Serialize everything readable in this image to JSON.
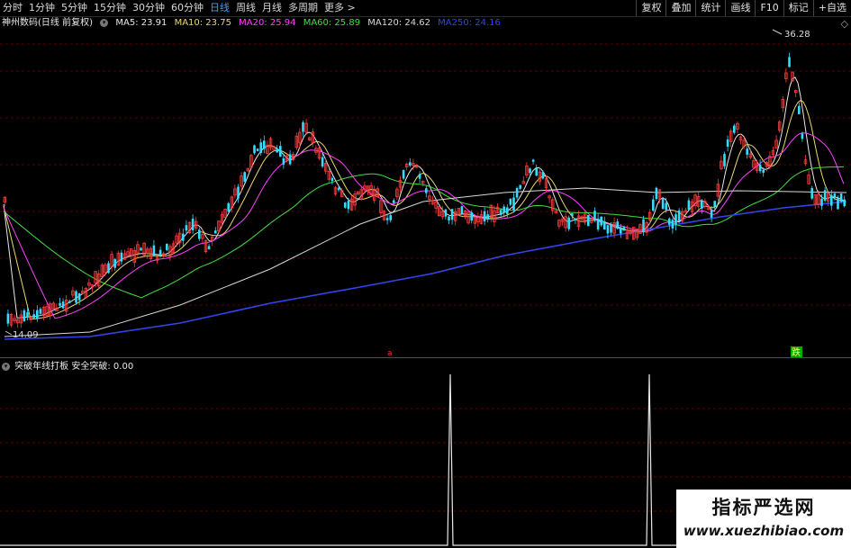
{
  "toolbar": {
    "periods": [
      "分时",
      "1分钟",
      "5分钟",
      "15分钟",
      "30分钟",
      "60分钟",
      "日线",
      "周线",
      "月线",
      "多周期",
      "更多 >"
    ],
    "active_period": "日线",
    "tools": [
      "复权",
      "叠加",
      "统计",
      "画线",
      "F10",
      "标记",
      "+自选"
    ]
  },
  "legend": {
    "stock_name": "神州数码(日线 前复权)",
    "ma5": "MA5: 23.91",
    "ma10": "MA10: 23.75",
    "ma20": "MA20: 25.94",
    "ma60": "MA60: 25.89",
    "ma120": "MA120: 24.62",
    "ma250": "MA250: 24.16"
  },
  "price_chart": {
    "high_label": "36.28",
    "low_label": "14.09",
    "buy_marker": "a",
    "sell_marker": "跌"
  },
  "indicator": {
    "label": "突破年线打板 安全突破: 0.00"
  },
  "watermark": {
    "title": "指标严选网",
    "url": "www.xuezhibiao.com"
  },
  "colors": {
    "up": "#ff3c3c",
    "down": "#33ddff",
    "ma5": "#e8e8e8",
    "ma10": "#e8d870",
    "ma20": "#ff40ff",
    "ma60": "#40e040",
    "ma120": "#d8d8d8",
    "ma250": "#3344ee",
    "active": "#3aa0ff"
  }
}
